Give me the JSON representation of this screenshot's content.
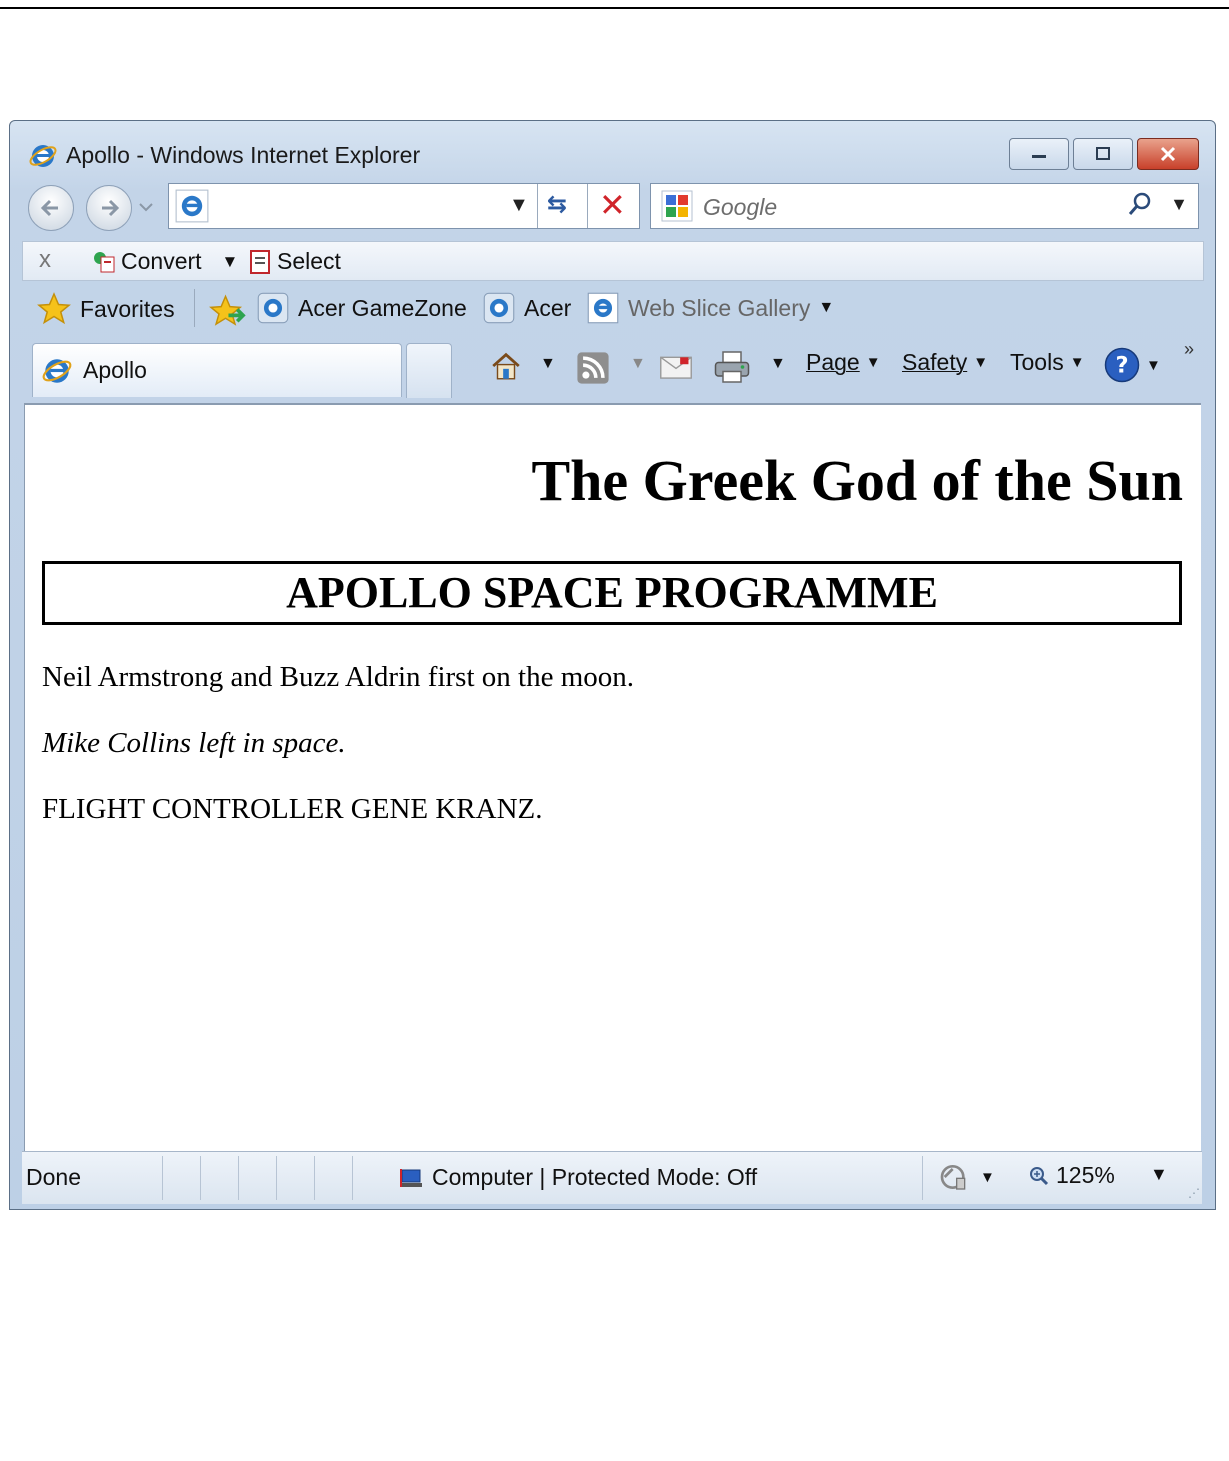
{
  "window": {
    "title": "Apollo - Windows Internet Explorer"
  },
  "navigation": {
    "address_value": "",
    "search_placeholder": "Google"
  },
  "convert_bar": {
    "close_label": "x",
    "convert_label": "Convert",
    "select_label": "Select"
  },
  "favorites_bar": {
    "favorites_label": "Favorites",
    "items": [
      {
        "label": "Acer GameZone"
      },
      {
        "label": "Acer"
      },
      {
        "label": "Web Slice Gallery"
      }
    ]
  },
  "tab": {
    "label": "Apollo"
  },
  "command_bar": {
    "page": "Page",
    "safety": "Safety",
    "tools": "Tools",
    "overflow": "»"
  },
  "page": {
    "heading": "The Greek God of the Sun",
    "boxed_heading": "APOLLO SPACE PROGRAMME",
    "paragraphs": [
      "Neil Armstrong and Buzz Aldrin first on the moon.",
      "Mike Collins left in space.",
      "FLIGHT CONTROLLER GENE KRANZ."
    ]
  },
  "status_bar": {
    "status": "Done",
    "zone": "Computer | Protected Mode: Off",
    "zoom": "125%"
  },
  "colors": {
    "frame": "#c3d4e8",
    "close_button": "#c8402a",
    "stop_icon": "#d0242a"
  }
}
